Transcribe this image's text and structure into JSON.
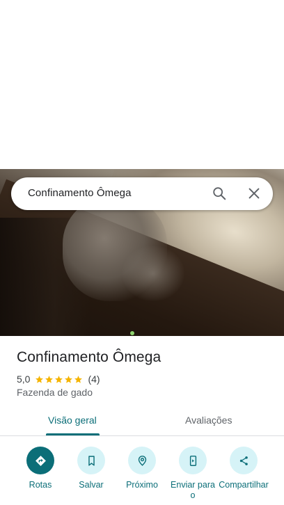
{
  "search": {
    "query": "Confinamento Ômega"
  },
  "place": {
    "title": "Confinamento Ômega",
    "rating": "5,0",
    "rating_value": 5,
    "review_count": "(4)",
    "category": "Fazenda de gado"
  },
  "tabs": [
    {
      "label": "Visão geral",
      "active": true
    },
    {
      "label": "Avaliações",
      "active": false
    }
  ],
  "actions": [
    {
      "label": "Rotas",
      "icon": "directions-icon"
    },
    {
      "label": "Salvar",
      "icon": "bookmark-icon"
    },
    {
      "label": "Próximo",
      "icon": "nearby-icon"
    },
    {
      "label": "Enviar para o",
      "icon": "send-to-phone-icon"
    },
    {
      "label": "Compartilhar",
      "icon": "share-icon"
    }
  ],
  "colors": {
    "accent": "#0b6e78",
    "action_bg": "#d6f3f7",
    "star": "#f5b400",
    "photo_dot": "#8ed36f"
  }
}
